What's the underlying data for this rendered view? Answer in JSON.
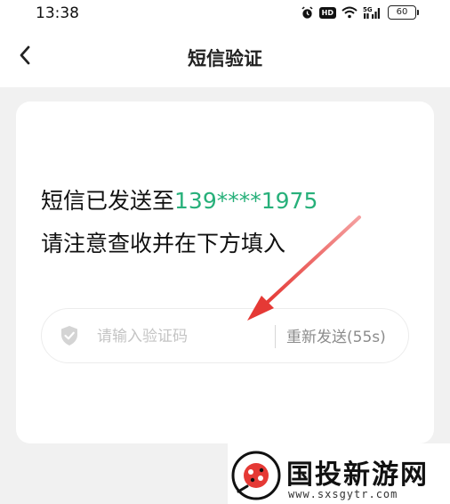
{
  "status_bar": {
    "time": "13:38",
    "hd_label": "HD",
    "signal_label": "5G",
    "battery": "60"
  },
  "header": {
    "title": "短信验证",
    "back_icon": "chevron-left-icon"
  },
  "message": {
    "line1_prefix": "短信已发送至",
    "phone": "139****1975",
    "line2": "请注意查收并在下方填入"
  },
  "code_field": {
    "placeholder": "请输入验证码",
    "value": "",
    "icon": "shield-check-icon",
    "resend_label": "重新发送(55s)"
  },
  "colors": {
    "accent_green": "#27b07a",
    "arrow_red": "#e53935"
  },
  "watermark": {
    "name": "国投新游网",
    "url": "www.sxsgytr.com"
  }
}
